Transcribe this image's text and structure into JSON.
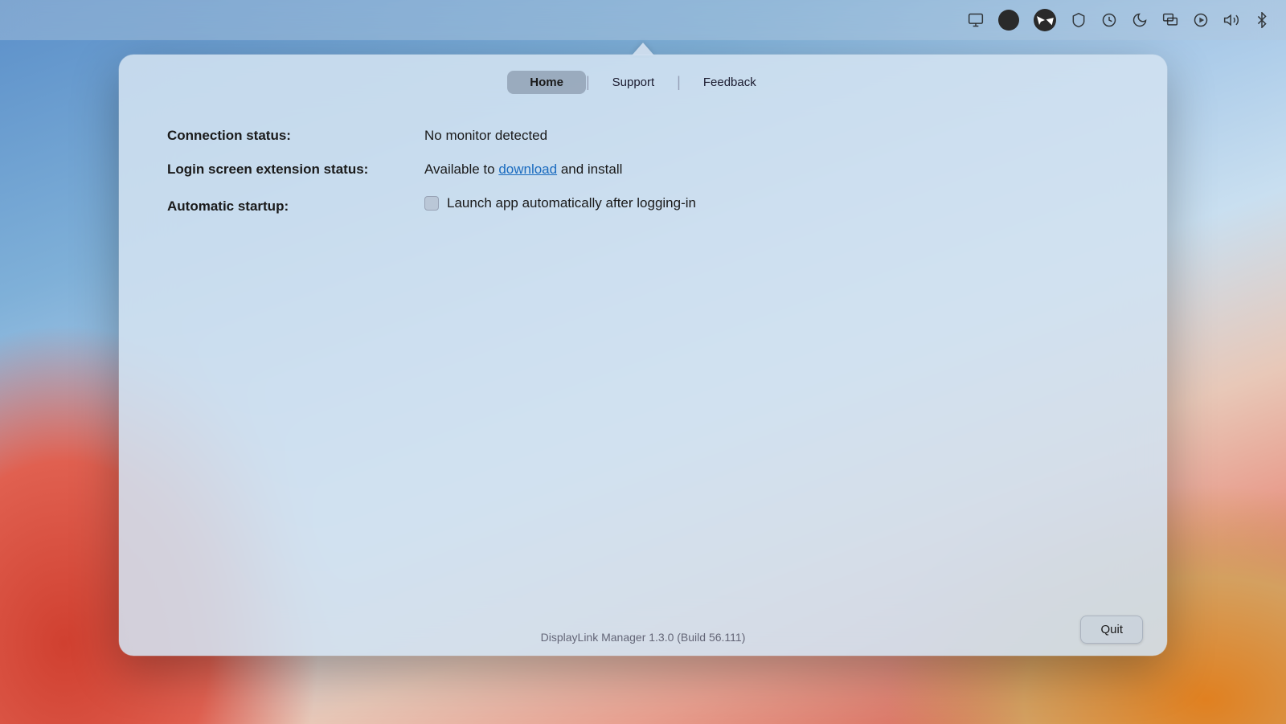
{
  "desktop": {
    "bg_description": "macOS Big Sur wallpaper"
  },
  "menubar": {
    "icons": [
      {
        "name": "display-icon",
        "symbol": "⬛"
      },
      {
        "name": "profile-circle-icon",
        "symbol": "●"
      },
      {
        "name": "cursor-icon",
        "symbol": "▶"
      },
      {
        "name": "malwarebytes-icon",
        "symbol": "M"
      },
      {
        "name": "time-machine-icon",
        "symbol": "⏰"
      },
      {
        "name": "night-shift-icon",
        "symbol": "🌙"
      },
      {
        "name": "screen-mirror-icon",
        "symbol": "⬜"
      },
      {
        "name": "play-icon",
        "symbol": "▶"
      },
      {
        "name": "volume-icon",
        "symbol": "🔊"
      },
      {
        "name": "bluetooth-icon",
        "symbol": "ᛒ"
      }
    ]
  },
  "tabs": {
    "home": "Home",
    "support": "Support",
    "feedback": "Feedback",
    "active": "home"
  },
  "content": {
    "connection_status_label": "Connection status:",
    "connection_status_value": "No monitor detected",
    "login_screen_label": "Login screen extension status:",
    "login_screen_prefix": "Available to ",
    "login_screen_link": "download",
    "login_screen_suffix": " and install",
    "automatic_startup_label": "Automatic startup:",
    "automatic_startup_checkbox_label": "Launch app automatically after logging-in"
  },
  "footer": {
    "version_text": "DisplayLink Manager 1.3.0 (Build 56.111)",
    "quit_button": "Quit"
  }
}
